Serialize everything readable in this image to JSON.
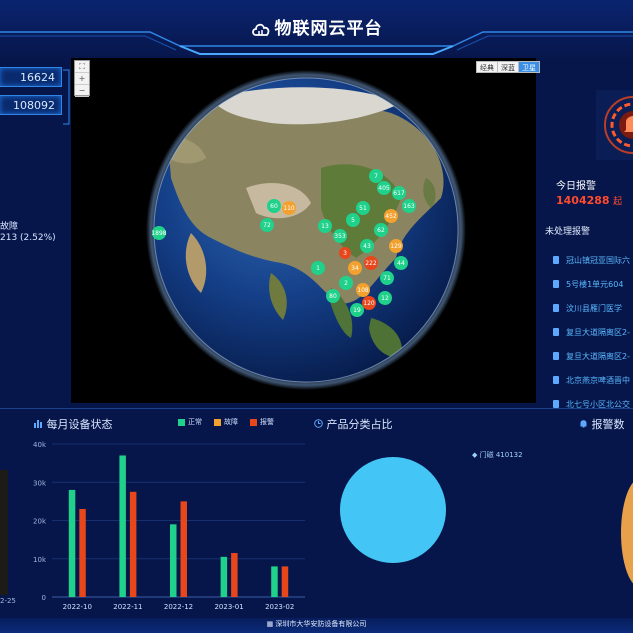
{
  "header": {
    "title": "物联网云平台",
    "icon": "cloud-icon",
    "accent": "#2f86e6"
  },
  "counters": [
    {
      "value": "16624"
    },
    {
      "value": "108092"
    }
  ],
  "left_panel": {
    "fault_label": "故障",
    "fault_value": "213 (2.52%)"
  },
  "map": {
    "controls": [
      "⛶",
      "+",
      "−"
    ],
    "types": [
      {
        "label": "经典"
      },
      {
        "label": "深蓝"
      },
      {
        "label": "卫星"
      }
    ],
    "active_type": "卫星",
    "markers": [
      {
        "label": "1898"
      },
      {
        "label": "60"
      },
      {
        "label": "72"
      },
      {
        "label": "110"
      },
      {
        "label": "13"
      },
      {
        "label": "353"
      },
      {
        "label": "5"
      },
      {
        "label": "1"
      },
      {
        "label": "405"
      },
      {
        "label": "452"
      },
      {
        "label": "617"
      },
      {
        "label": "51"
      },
      {
        "label": "43"
      },
      {
        "label": "129"
      },
      {
        "label": "62"
      },
      {
        "label": "222"
      },
      {
        "label": "34"
      },
      {
        "label": "71"
      },
      {
        "label": "2"
      },
      {
        "label": "108"
      },
      {
        "label": "12"
      },
      {
        "label": "80"
      },
      {
        "label": "120"
      },
      {
        "label": "44"
      },
      {
        "label": "3"
      },
      {
        "label": "7"
      },
      {
        "label": "163"
      },
      {
        "label": "19"
      }
    ]
  },
  "right_panel": {
    "today_label": "今日报警",
    "today_value": "1404288",
    "today_unit": "起",
    "unhandled_label": "未处理报警",
    "alarms": [
      {
        "text": "冠山镇冠亚国际六"
      },
      {
        "text": "5号楼1单元604"
      },
      {
        "text": "汶川县雁门医学"
      },
      {
        "text": "复旦大道隔离区2-"
      },
      {
        "text": "复旦大道隔离区2-"
      },
      {
        "text": "北京燕京啤酒晋中"
      },
      {
        "text": "北七号小区北公交"
      }
    ]
  },
  "bar_panel": {
    "title": "每月设备状态",
    "icon": "chart-bar-icon"
  },
  "pie_panel": {
    "title": "产品分类占比",
    "icon": "clock-icon",
    "label": "门磁 410132"
  },
  "alarm_panel": {
    "title": "报警数",
    "icon": "bell-icon"
  },
  "left_bottom": {
    "date": "2-25"
  },
  "footer": {
    "text": "深圳市大华安防设备有限公司",
    "icon": "building-icon"
  },
  "chart_data": {
    "type": "bar",
    "categories": [
      "2022-10",
      "2022-11",
      "2022-12",
      "2023-01",
      "2023-02"
    ],
    "series": [
      {
        "name": "正常",
        "color": "#1fd18a",
        "values": [
          28000,
          37000,
          19000,
          10500,
          8000
        ]
      },
      {
        "name": "故障",
        "color": "#f2a12e",
        "values": [
          0,
          0,
          0,
          0,
          0
        ]
      },
      {
        "name": "报警",
        "color": "#e8461b",
        "values": [
          23000,
          27500,
          25000,
          11500,
          8000
        ]
      }
    ],
    "yticks": [
      "0",
      "10k",
      "20k",
      "30k",
      "40k"
    ],
    "ylim": [
      0,
      40000
    ]
  }
}
